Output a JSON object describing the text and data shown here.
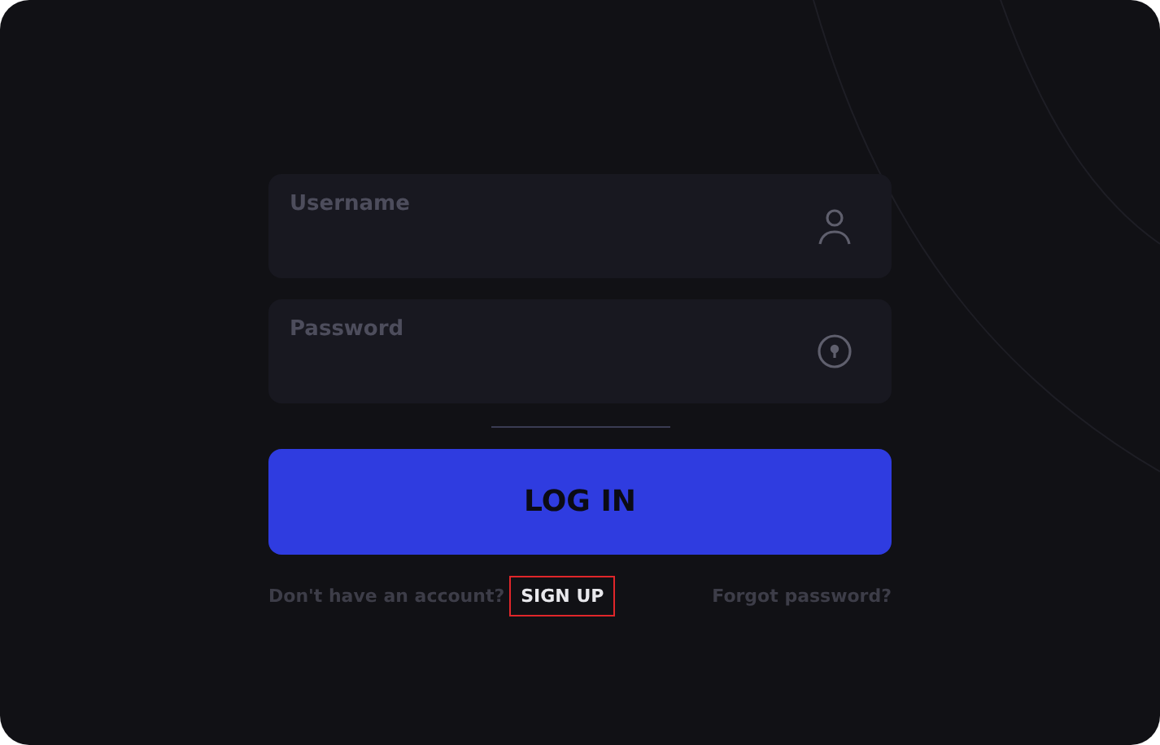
{
  "fields": [
    {
      "kind": "text",
      "placeholder": "Username"
    },
    {
      "kind": "password",
      "placeholder": "Password"
    }
  ],
  "login_button": "LOG IN",
  "signup_prompt": "Don't have an account?",
  "signup_link": {
    "label": "SIGN UP",
    "highlighted": true
  },
  "forgot_link": "Forgot password?"
}
